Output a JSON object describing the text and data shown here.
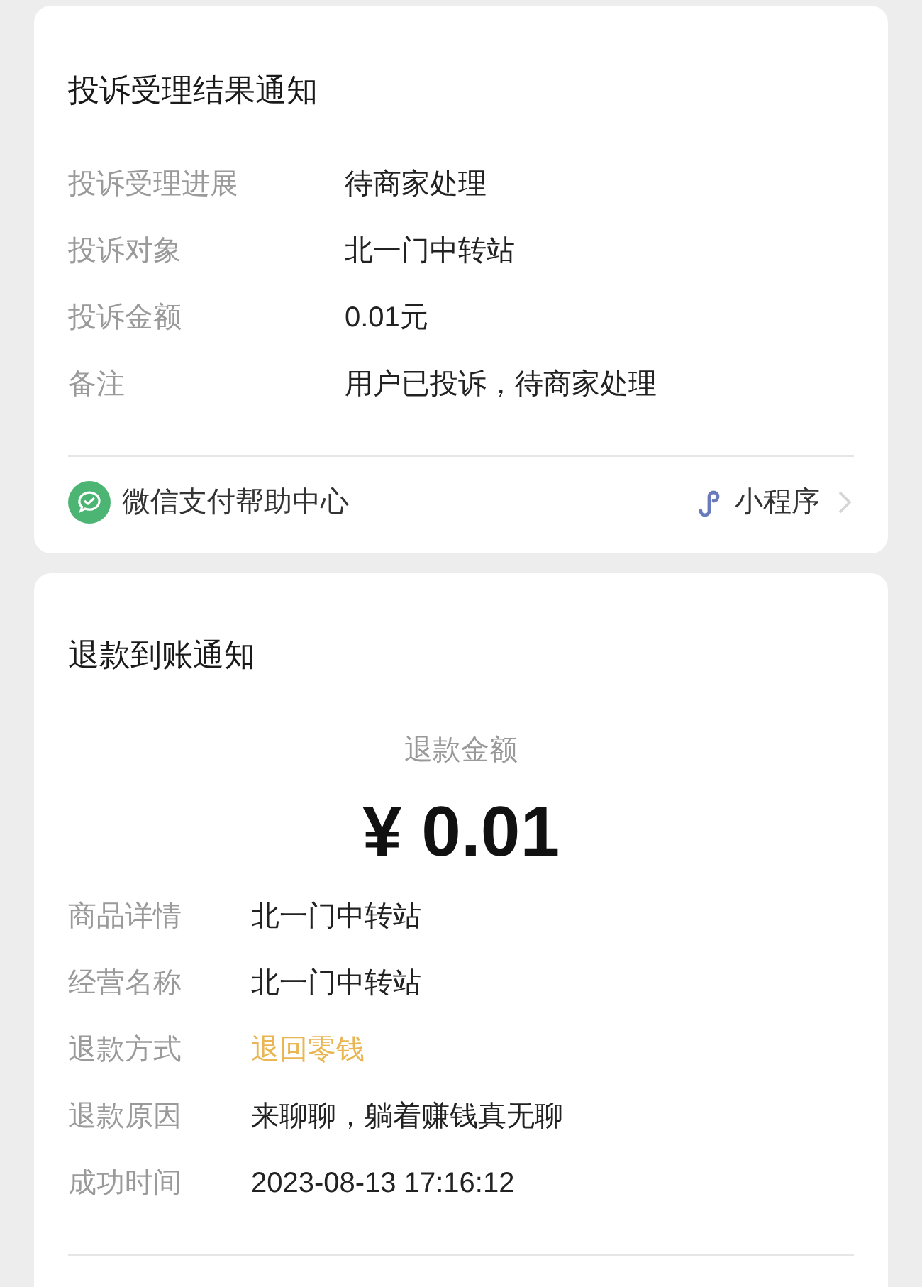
{
  "complaint_card": {
    "title": "投诉受理结果通知",
    "rows": [
      {
        "label": "投诉受理进展",
        "value": "待商家处理"
      },
      {
        "label": "投诉对象",
        "value": "北一门中转站"
      },
      {
        "label": "投诉金额",
        "value": "0.01元"
      },
      {
        "label": "备注",
        "value": "用户已投诉，待商家处理"
      }
    ],
    "footer": {
      "source": "微信支付帮助中心",
      "link": "小程序"
    }
  },
  "refund_card": {
    "title": "退款到账通知",
    "amount_label": "退款金额",
    "amount": "¥ 0.01",
    "rows": [
      {
        "label": "商品详情",
        "value": "北一门中转站",
        "kind": "plain"
      },
      {
        "label": "经营名称",
        "value": "北一门中转站",
        "kind": "plain"
      },
      {
        "label": "退款方式",
        "value": "退回零钱",
        "kind": "highlight"
      },
      {
        "label": "退款原因",
        "value": "来聊聊，躺着赚钱真无聊",
        "kind": "plain"
      },
      {
        "label": "成功时间",
        "value": "2023-08-13 17:16:12",
        "kind": "plain"
      }
    ]
  }
}
